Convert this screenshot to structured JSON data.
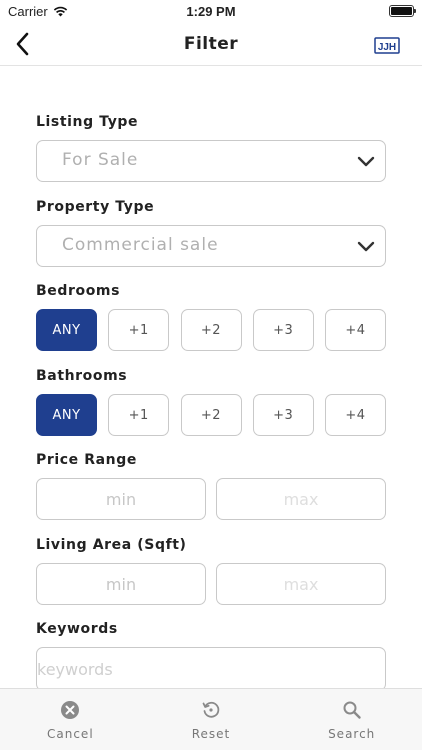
{
  "status_bar": {
    "carrier": "Carrier",
    "time": "1:29 PM"
  },
  "nav": {
    "title": "Filter",
    "logo_text": "JJH",
    "brand_color": "#1f3f8f"
  },
  "listing_type": {
    "label": "Listing Type",
    "value": "For Sale"
  },
  "property_type": {
    "label": "Property Type",
    "value": "Commercial sale"
  },
  "bedrooms": {
    "label": "Bedrooms",
    "options": [
      "ANY",
      "+1",
      "+2",
      "+3",
      "+4"
    ],
    "selected": "ANY"
  },
  "bathrooms": {
    "label": "Bathrooms",
    "options": [
      "ANY",
      "+1",
      "+2",
      "+3",
      "+4"
    ],
    "selected": "ANY"
  },
  "price_range": {
    "label": "Price Range",
    "min_placeholder": "min",
    "max_placeholder": "max"
  },
  "living_area": {
    "label": "Living Area (Sqft)",
    "min_placeholder": "min",
    "max_placeholder": "max"
  },
  "keywords": {
    "label": "Keywords",
    "placeholder": "keywords"
  },
  "toolbar": {
    "cancel_label": "Cancel",
    "reset_label": "Reset",
    "search_label": "Search"
  },
  "icons": {
    "back": "chevron-left-icon",
    "cancel": "close-circle-icon",
    "reset": "reset-icon",
    "search": "search-icon"
  }
}
